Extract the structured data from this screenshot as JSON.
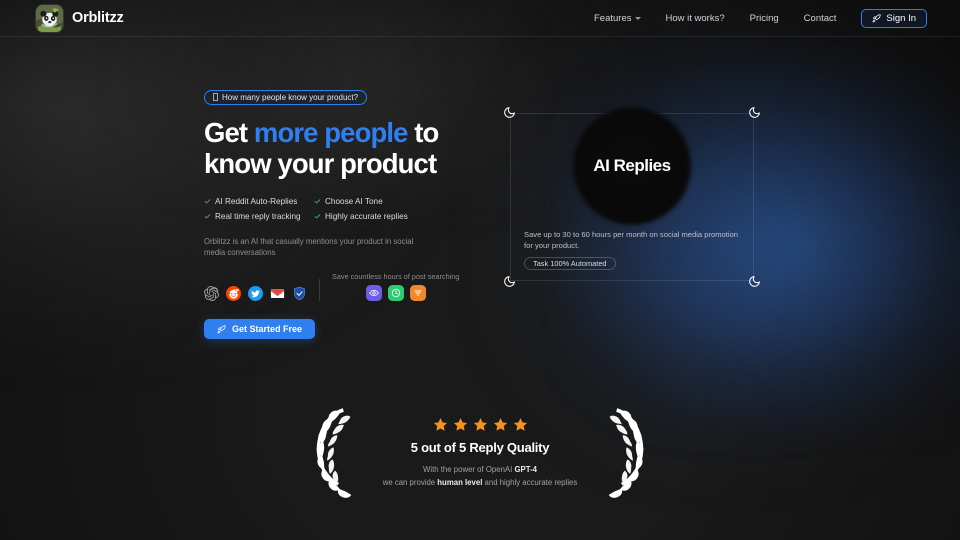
{
  "colors": {
    "background": "#1a1a1a",
    "accent_blue": "#2f7ff0",
    "glow_blue": "#2e5696",
    "check_green": "#3aa95e",
    "star_orange": "#f5921e"
  },
  "header": {
    "brand_name": "Orblitzz",
    "brand_logo_icon": "panda-logo-icon",
    "nav": [
      {
        "label": "Features",
        "has_dropdown": true,
        "icon": "chevron-down-icon"
      },
      {
        "label": "How it works?",
        "has_dropdown": false
      },
      {
        "label": "Pricing",
        "has_dropdown": false
      },
      {
        "label": "Contact",
        "has_dropdown": false
      }
    ],
    "sign_in": {
      "label": "Sign In",
      "icon": "rocket-icon"
    }
  },
  "hero": {
    "badge": {
      "label": "How many people know your product?",
      "icon": "missing-glyph-box"
    },
    "headline": {
      "line1_pre": "Get ",
      "line1_accent": "more people",
      "line1_post": " to",
      "line2": "know your product"
    },
    "features": [
      {
        "label": "AI Reddit Auto-Replies",
        "icon": "check-icon"
      },
      {
        "label": "Choose AI Tone",
        "icon": "check-icon"
      },
      {
        "label": "Real time reply tracking",
        "icon": "check-icon"
      },
      {
        "label": "Highly accurate replies",
        "icon": "check-icon"
      }
    ],
    "subtext": "Orblitzz is an AI that casually mentions your product in social media conversations",
    "brand_logos": [
      {
        "name": "openai-icon"
      },
      {
        "name": "reddit-icon"
      },
      {
        "name": "twitter-icon"
      },
      {
        "name": "gmail-icon"
      },
      {
        "name": "brave-shield-icon"
      }
    ],
    "save_block": {
      "label": "Save countless hours of post searching",
      "app_icons": [
        {
          "name": "eye-icon",
          "color": "#6c5ce7"
        },
        {
          "name": "clock-icon",
          "color": "#2ecc71"
        },
        {
          "name": "filter-sliders-icon",
          "color": "#f0872a"
        }
      ]
    },
    "cta": {
      "label": "Get Started Free",
      "icon": "rocket-icon"
    }
  },
  "card": {
    "corner_icon": "crescent-moon-icon",
    "title": "AI Replies",
    "description": "Save up to 30 to 60 hours per month on social media promotion for your product.",
    "pill_label": "Task 100% Automated"
  },
  "rating": {
    "stars_filled": 5,
    "stars_total": 5,
    "star_icon": "star-icon",
    "laurel_icon": "laurel-wreath-icon",
    "title": "5 out of 5 Reply Quality",
    "sub_line1_pre": "With the power of OpenAI ",
    "sub_line1_bold": "GPT-4",
    "sub_line2_pre": "we can provide ",
    "sub_line2_bold": "human level",
    "sub_line2_post": " and highly accurate replies"
  }
}
